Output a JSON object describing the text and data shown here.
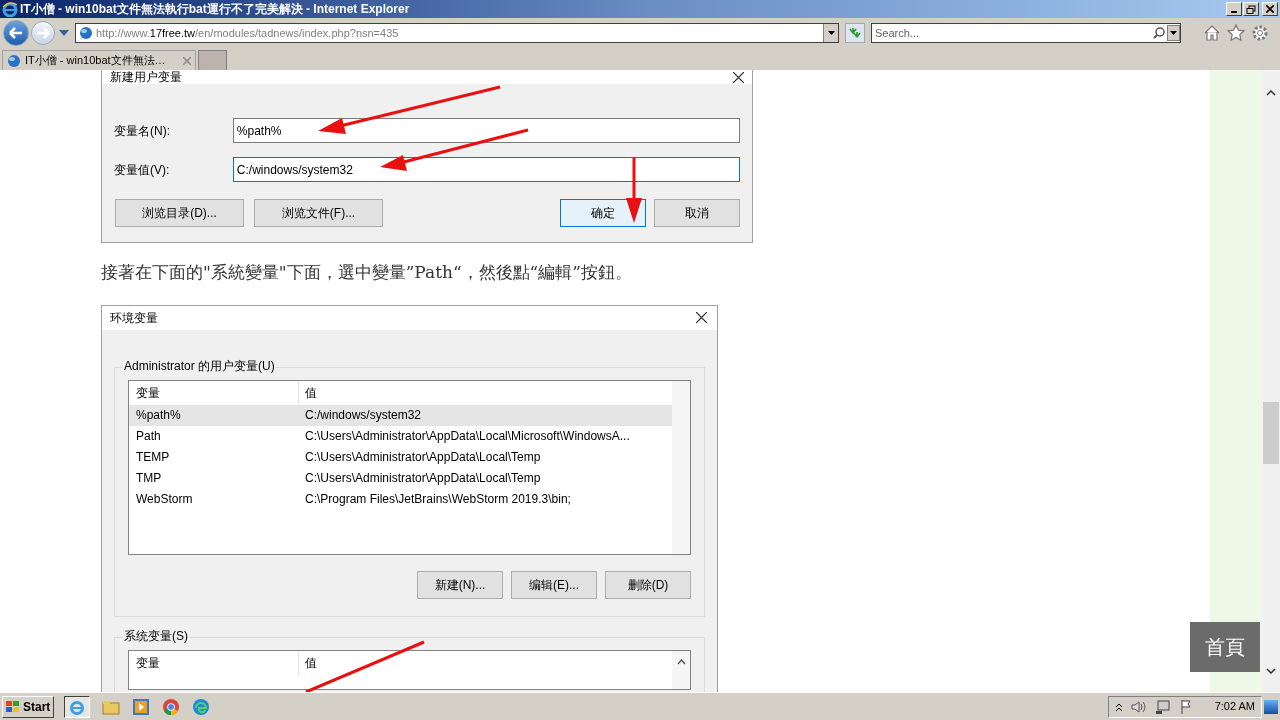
{
  "window": {
    "title": "IT小僧 - win10bat文件無法執行bat運行不了完美解決 - Internet Explorer"
  },
  "toolbar": {
    "address": {
      "prefix": "http://www.",
      "domain": "17free.tw",
      "path": "/en/modules/tadnews/index.php?nsn=435"
    },
    "search_placeholder": "Search..."
  },
  "tabs": [
    {
      "label": "IT小僧 - win10bat文件無法…",
      "selected": true
    }
  ],
  "new_var_dialog": {
    "title": "新建用户变量",
    "fields": [
      {
        "label": "变量名(N):",
        "value": "%path%",
        "focused": false
      },
      {
        "label": "变量值(V):",
        "value": "C:/windows/system32",
        "focused": true
      }
    ],
    "buttons": [
      {
        "label": "浏览目录(D)...",
        "default": false
      },
      {
        "label": "浏览文件(F)...",
        "default": false
      },
      {
        "label": "确定",
        "default": true
      },
      {
        "label": "取消",
        "default": false
      }
    ]
  },
  "paragraph": "接著在下面的\"系統變量\"下面，選中變量”Path“，然後點“編輯”按鈕。",
  "env_dialog": {
    "title": "环境变量",
    "user_group": {
      "label": "Administrator 的用户变量(U)",
      "columns": [
        "变量",
        "值"
      ],
      "rows": [
        {
          "name": "%path%",
          "value": "C:/windows/system32",
          "selected": true
        },
        {
          "name": "Path",
          "value": "C:\\Users\\Administrator\\AppData\\Local\\Microsoft\\WindowsA...",
          "selected": false
        },
        {
          "name": "TEMP",
          "value": "C:\\Users\\Administrator\\AppData\\Local\\Temp",
          "selected": false
        },
        {
          "name": "TMP",
          "value": "C:\\Users\\Administrator\\AppData\\Local\\Temp",
          "selected": false
        },
        {
          "name": "WebStorm",
          "value": "C:\\Program Files\\JetBrains\\WebStorm 2019.3\\bin;",
          "selected": false
        }
      ],
      "buttons": [
        "新建(N)...",
        "编辑(E)...",
        "删除(D)"
      ]
    },
    "system_group": {
      "label": "系统变量(S)",
      "columns": [
        "变量",
        "值"
      ]
    }
  },
  "home_button": "首頁",
  "taskbar": {
    "start": "Start",
    "clock": "7:02 AM"
  }
}
